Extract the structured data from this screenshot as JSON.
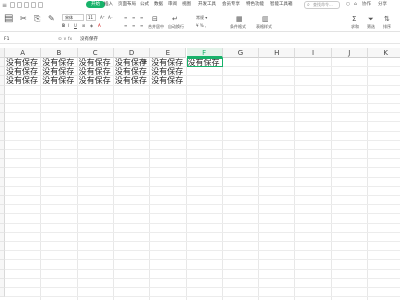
{
  "ribbon_tabs": {
    "menu_icon": "≡",
    "start": "开始",
    "insert": "插入",
    "page_layout": "页面布局",
    "formula": "公式",
    "data": "数据",
    "review": "审阅",
    "view": "视图",
    "developer": "开发工具",
    "member": "会员专享",
    "special": "特色功能",
    "smart_toolbox": "智能工具箱",
    "search_placeholder": "查找命令...",
    "right_tools": [
      "○",
      "⌂",
      "协作",
      "分享"
    ]
  },
  "ribbon": {
    "font_name": "宋体",
    "font_size": "11",
    "labels": {
      "merge_center": "合并居中",
      "auto_wrap": "自动换行",
      "conditional_format": "条件格式",
      "table_style": "表格样式",
      "sum": "求和",
      "filter": "筛选",
      "sort": "排序"
    }
  },
  "formula_bar": {
    "name_box": "F1",
    "fx_icons": "⊙ ∨ fx",
    "content": "没有保存"
  },
  "grid": {
    "columns": [
      "A",
      "B",
      "C",
      "D",
      "E",
      "F",
      "G",
      "H",
      "I",
      "J",
      "K"
    ],
    "selected_column": "F",
    "rows": [
      [
        "没有保存",
        "没有保存",
        "没有保存",
        "没有保存",
        "没有保存",
        "没有保存"
      ],
      [
        "没有保存",
        "没有保存",
        "没有保存",
        "没有保存",
        "没有保存"
      ],
      [
        "没有保存",
        "没有保存",
        "没有保存",
        "没有保存",
        "没有保存"
      ]
    ],
    "active_cell": "F1"
  }
}
